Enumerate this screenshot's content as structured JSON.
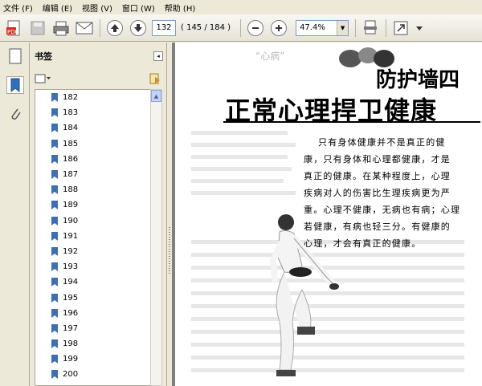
{
  "menu": [
    "文件 (F)",
    "编辑 (E)",
    "视图 (V)",
    "窗口 (W)",
    "帮助 (H)"
  ],
  "toolbar": {
    "current_page": "132",
    "page_count": "( 145 / 184 )",
    "zoom": "47.4%"
  },
  "bookmarks_panel": {
    "title": "书签",
    "items": [
      "182",
      "183",
      "184",
      "185",
      "186",
      "187",
      "188",
      "189",
      "190",
      "191",
      "192",
      "193",
      "194",
      "195",
      "196",
      "197",
      "198",
      "199",
      "200"
    ]
  },
  "document": {
    "ghost_title": "“心病”",
    "heading_small": "防护墙四",
    "heading_big": "正常心理捍卫健康",
    "lines": [
      "只有身体健康并不是真正的健",
      "康，只有身体和心理都健康，才是",
      "真正的健康。在某种程度上，心理",
      "疾病对人的伤害比生理疾病更为严",
      "重。心理不健康，无病也有病；心理",
      "若健康，有病也轻三分。有健康的",
      "心理，才会有真正的健康。"
    ]
  }
}
